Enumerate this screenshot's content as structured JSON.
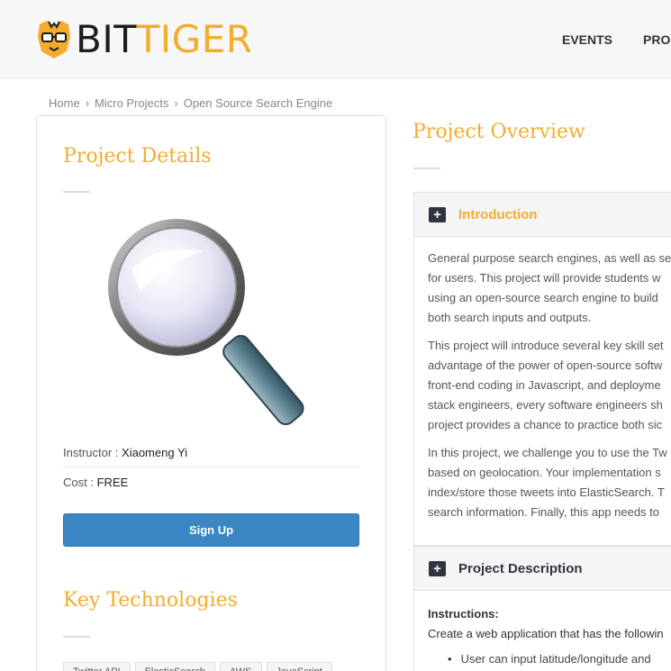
{
  "header": {
    "logo_part1": "BIT",
    "logo_part2": "TIGER",
    "nav": [
      "EVENTS",
      "PROJE"
    ]
  },
  "breadcrumb": [
    "Home",
    "Micro Projects",
    "Open Source Search Engine"
  ],
  "details": {
    "title": "Project Details",
    "image_icon": "magnifying-glass-icon",
    "instructor_label": "Instructor : ",
    "instructor": "Xiaomeng Yi",
    "cost_label": "Cost : ",
    "cost": "FREE",
    "signup_label": "Sign Up",
    "key_title": "Key Technologies",
    "tags": [
      "Twitter API",
      "ElasticSearch",
      "AWS",
      "JavaScript"
    ]
  },
  "overview": {
    "title": "Project Overview",
    "introduction": {
      "label": "Introduction",
      "paragraphs": [
        [
          "General purpose search engines, as well as se",
          "for users. This project will provide students w",
          "using an open-source search engine to build",
          "both search inputs and outputs."
        ],
        [
          "This project will introduce several key skill set",
          "advantage of the power of open-source softw",
          "front-end coding in Javascript, and deployme",
          "stack engineers, every software engineers sh",
          "project provides a chance to practice both sic"
        ],
        [
          "In this project, we challenge you to use the Tw",
          "based on geolocation. Your implementation s",
          "index/store those tweets into ElasticSearch. T",
          "search information. Finally, this app needs to"
        ]
      ]
    },
    "description": {
      "label": "Project Description",
      "instructions_label": "Instructions:",
      "instructions_text": "Create a web application that has the followin",
      "bullet": "User can input latitude/longitude and"
    }
  },
  "colors": {
    "accent": "#f2ad2f",
    "button": "#3a87c3",
    "dark": "#2f3440"
  }
}
